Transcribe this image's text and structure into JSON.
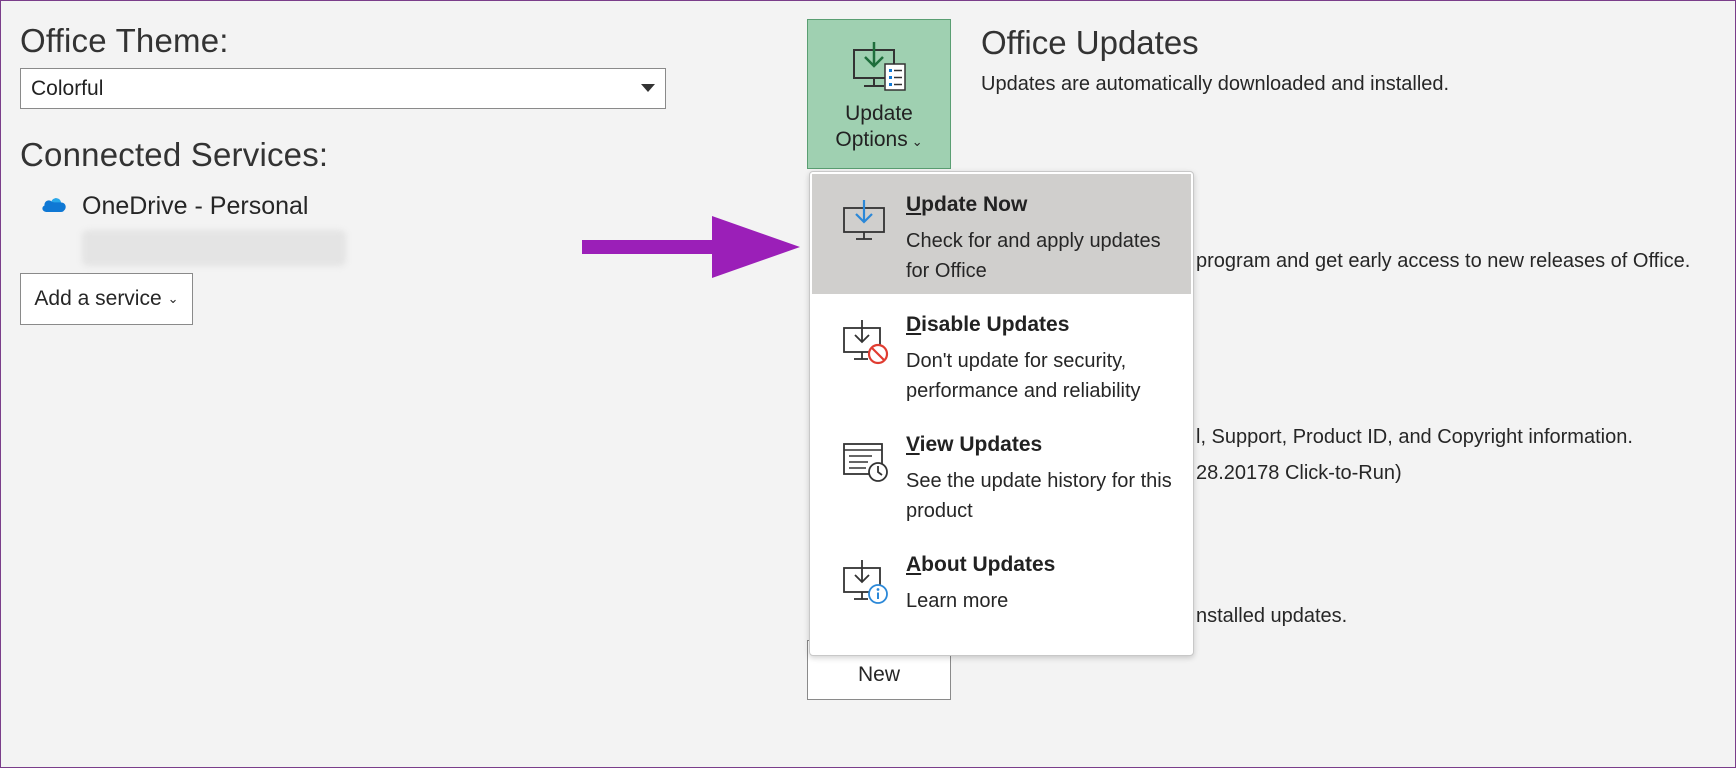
{
  "left": {
    "theme_heading": "Office Theme:",
    "theme_value": "Colorful",
    "services_heading": "Connected Services:",
    "onedrive_label": "OneDrive - Personal",
    "add_service_label": "Add a service"
  },
  "update_button": {
    "line1": "Update",
    "line2": "Options"
  },
  "office_updates": {
    "title": "Office Updates",
    "description": "Updates are automatically downloaded and installed."
  },
  "background_text": {
    "insider": "program and get early access to new releases of Office.",
    "about": "l, Support, Product ID, and Copyright information.",
    "version": "28.20178 Click-to-Run)",
    "installed": "nstalled updates."
  },
  "new_button_label": "New",
  "menu": {
    "items": [
      {
        "first": "U",
        "rest": "pdate Now",
        "desc": "Check for and apply updates for Office"
      },
      {
        "first": "D",
        "rest": "isable Updates",
        "desc": "Don't update for security, performance and reliability"
      },
      {
        "first": "V",
        "rest": "iew Updates",
        "desc": "See the update history for this product"
      },
      {
        "first": "A",
        "rest": "bout Updates",
        "desc": "Learn more"
      }
    ]
  },
  "colors": {
    "accent_green": "#9fd0b1",
    "highlight": "#d0cfcd",
    "arrow_purple": "#9b1fb8",
    "onedrive_blue": "#0f78d4"
  }
}
